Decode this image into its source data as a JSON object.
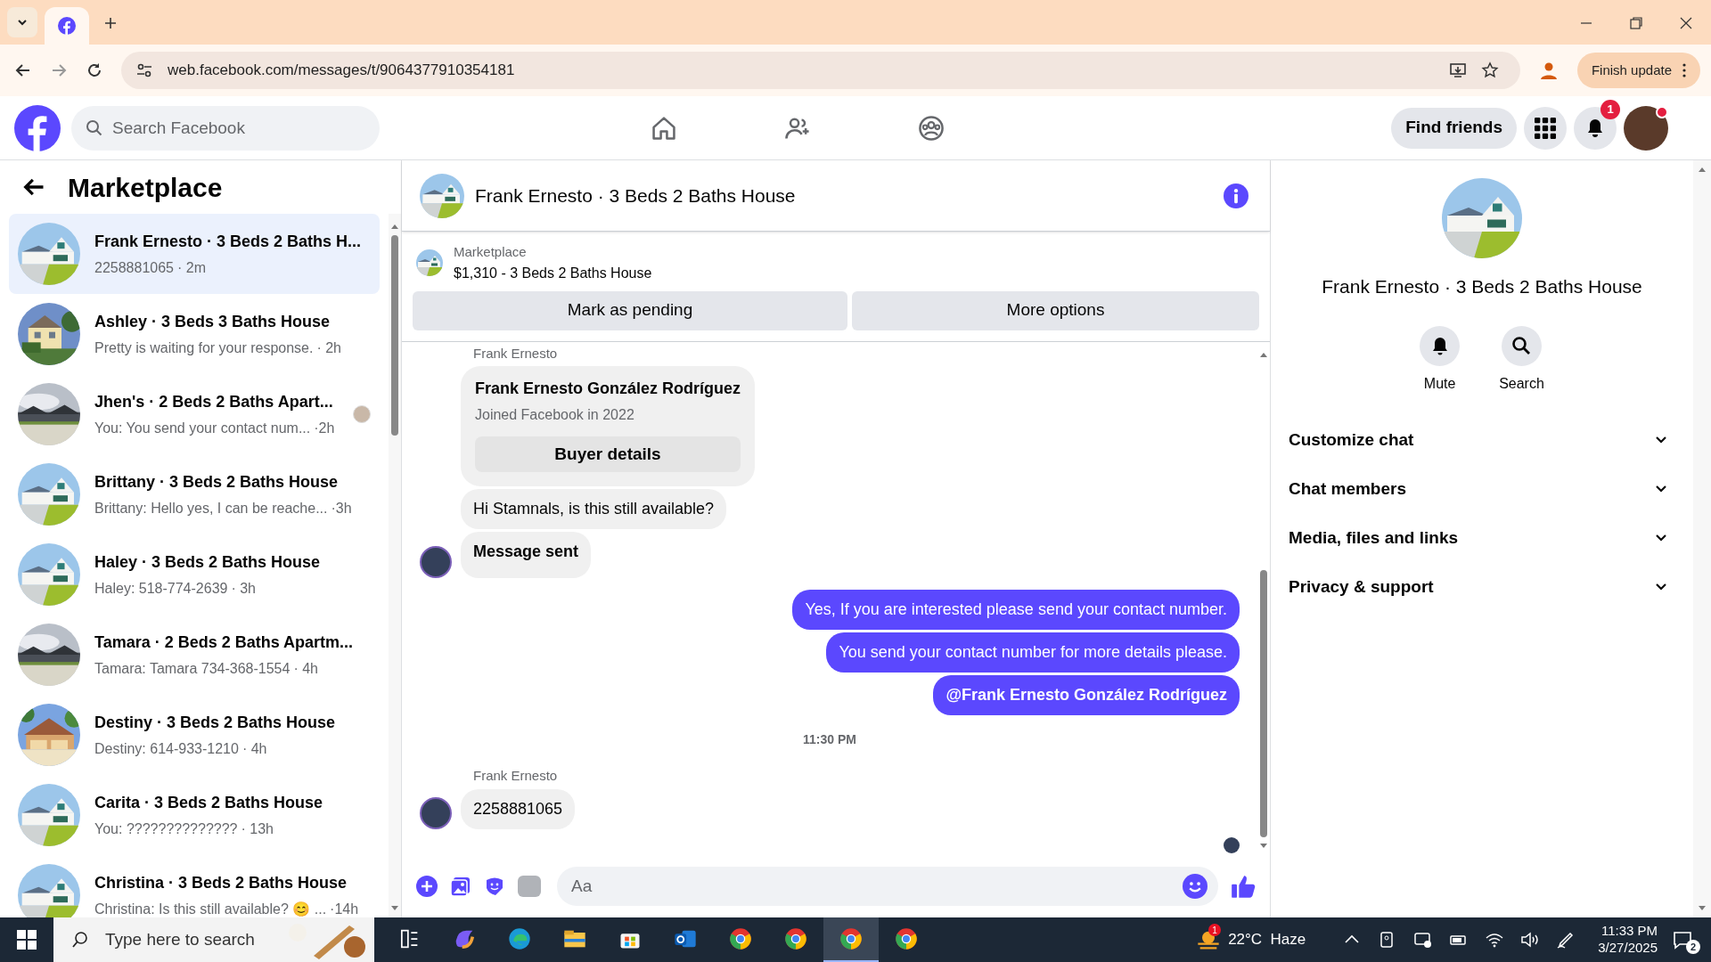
{
  "browser": {
    "url": "web.facebook.com/messages/t/9064377910354181",
    "update_button": "Finish update"
  },
  "top_nav": {
    "search_placeholder": "Search Facebook",
    "tabs": [
      {
        "kind": "home",
        "selected": false
      },
      {
        "kind": "friends",
        "selected": false
      },
      {
        "kind": "groups",
        "selected": false
      }
    ],
    "find_friends": "Find friends",
    "notification_count": "1"
  },
  "sidebar": {
    "title": "Marketplace",
    "conversations": [
      {
        "title": "Frank Ernesto · 3 Beds 2 Baths H...",
        "preview": "2258881065",
        "time": "· 2m",
        "selected": true,
        "seen_avatar": false
      },
      {
        "title": "Ashley · 3 Beds 3 Baths House",
        "preview": "Pretty is waiting for your response.",
        "time": "· 2h",
        "selected": false,
        "seen_avatar": false
      },
      {
        "title": "Jhen's · 2 Beds 2 Baths Apart...",
        "preview": "You: You send your contact num...",
        "time": "·2h",
        "selected": false,
        "seen_avatar": true
      },
      {
        "title": "Brittany · 3 Beds 2 Baths House",
        "preview": "Brittany: Hello yes, I can be reache...",
        "time": "·3h",
        "selected": false,
        "seen_avatar": false
      },
      {
        "title": "Haley · 3 Beds 2 Baths House",
        "preview": "Haley: 518-774-2639",
        "time": "· 3h",
        "selected": false,
        "seen_avatar": false
      },
      {
        "title": "Tamara · 2 Beds 2 Baths Apartm...",
        "preview": "Tamara: Tamara 734-368-1554",
        "time": "· 4h",
        "selected": false,
        "seen_avatar": false
      },
      {
        "title": "Destiny · 3 Beds 2 Baths House",
        "preview": "Destiny: 614-933-1210",
        "time": "· 4h",
        "selected": false,
        "seen_avatar": false
      },
      {
        "title": "Carita · 3 Beds 2 Baths House",
        "preview": "You: ??????????????",
        "time": "· 13h",
        "selected": false,
        "seen_avatar": false
      },
      {
        "title": "Christina · 3 Beds 2 Baths House",
        "preview": "Christina: Is this still available? 😊 ...",
        "time": "·14h",
        "selected": false,
        "seen_avatar": false
      }
    ]
  },
  "chat": {
    "title": "Frank Ernesto · 3 Beds 2 Baths House",
    "listing": {
      "label": "Marketplace",
      "name": "$1,310 - 3 Beds 2 Baths House"
    },
    "actions": [
      "Mark as pending",
      "More options"
    ],
    "messages": [
      {
        "kind": "sender",
        "text": "Frank Ernesto"
      },
      {
        "kind": "card",
        "name": "Frank Ernesto González Rodríguez",
        "detail": "Joined Facebook in 2022",
        "button": "Buyer details"
      },
      {
        "kind": "incoming",
        "text": "Hi Stamnals, is this still available?",
        "avatar": false
      },
      {
        "kind": "incoming_bold",
        "text": "Message sent",
        "avatar": true
      },
      {
        "kind": "outgoing",
        "text": "Yes, If you are interested please send your contact number."
      },
      {
        "kind": "outgoing",
        "text": "You send your contact number for more details please."
      },
      {
        "kind": "outgoing_bold",
        "text": "@Frank Ernesto González Rodríguez"
      },
      {
        "kind": "timestamp",
        "text": "11:30 PM"
      },
      {
        "kind": "sender",
        "text": "Frank Ernesto"
      },
      {
        "kind": "incoming",
        "text": "2258881065",
        "avatar": true
      }
    ],
    "composer_placeholder": "Aa"
  },
  "details": {
    "title": "Frank Ernesto · 3 Beds 2 Baths House",
    "actions": [
      {
        "kind": "mute",
        "label": "Mute"
      },
      {
        "kind": "search",
        "label": "Search"
      }
    ],
    "sections": [
      {
        "label": "Customize chat",
        "expanded": false
      },
      {
        "label": "Chat members",
        "expanded": false
      },
      {
        "label": "Media, files and links",
        "expanded": false
      },
      {
        "label": "Privacy & support",
        "expanded": false
      }
    ]
  },
  "taskbar": {
    "search_placeholder": "Type here to search",
    "apps": [
      {
        "kind": "taskview",
        "selected": false
      },
      {
        "kind": "copilot",
        "selected": false
      },
      {
        "kind": "edge",
        "selected": false
      },
      {
        "kind": "explorer",
        "selected": false
      },
      {
        "kind": "store",
        "selected": false
      },
      {
        "kind": "outlook",
        "selected": false
      },
      {
        "kind": "chrome",
        "selected": false
      },
      {
        "kind": "chrome",
        "selected": false
      },
      {
        "kind": "chrome",
        "selected": true
      },
      {
        "kind": "chrome",
        "selected": false
      }
    ],
    "weather_badge": "1",
    "weather": "22°C  Haze",
    "time": "11:33 PM",
    "date": "3/27/2025",
    "notifications": "2"
  }
}
